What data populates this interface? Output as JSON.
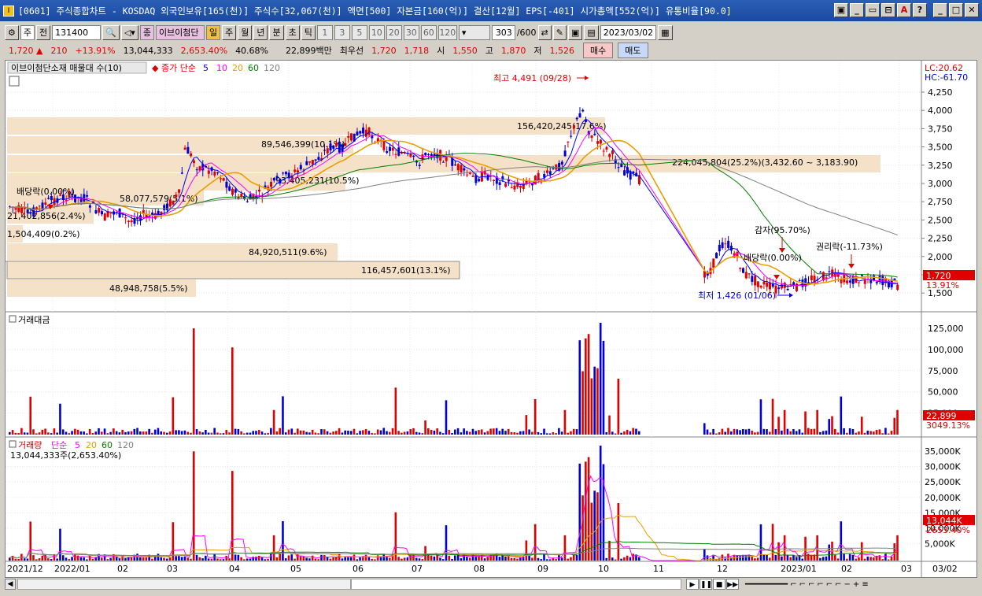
{
  "window": {
    "title": "[0601] 주식종합차트 - KOSDAQ 외국인보유[165(천)] 주식수[32,067(천)] 액면[500] 자본금[160(억)] 결산[12월] EPS[-401] 시가총액[552(억)] 유통비율[90.0]",
    "buttons": [
      "▣",
      "_",
      "□",
      "▭",
      "A",
      "?",
      "_",
      "□",
      "X"
    ]
  },
  "toolbar": {
    "period": "주",
    "jeon": "전",
    "code": "131400",
    "name": "이브이첨단",
    "badge": "종",
    "timeframes": [
      "일",
      "주",
      "월",
      "년",
      "분",
      "초",
      "틱"
    ],
    "selected_timeframe": "일",
    "intervals": [
      "1",
      "3",
      "5",
      "10",
      "20",
      "30",
      "60",
      "120"
    ],
    "count": "303",
    "count_total": "/600",
    "date": "2023/03/02"
  },
  "quote": {
    "price": "1,720",
    "change": "210",
    "change_pct": "+13.91%",
    "volume": "13,044,333",
    "volume_pct": "2,653.40%",
    "ratio": "40.68%",
    "amount": "22,899백만",
    "best_bid_label": "최우선",
    "best_ask": "1,720",
    "best_bid": "1,718",
    "open_label": "시",
    "open": "1,550",
    "high_label": "고",
    "high": "1,870",
    "low_label": "저",
    "low": "1,526",
    "buy_label": "매수",
    "sell_label": "매도"
  },
  "price_panel": {
    "title": "이브이첨단소재 매물대 수(10)",
    "ma_label": "종가 단순",
    "ma_periods": [
      "5",
      "10",
      "20",
      "60",
      "120"
    ],
    "ma_colors": [
      "#0000ff",
      "#ff00ff",
      "#e8a000",
      "#008000",
      "#808080"
    ],
    "lc": "LC:20.62",
    "hc": "HC:-61.70",
    "yticks": [
      "4,250",
      "4,000",
      "3,750",
      "3,500",
      "3,250",
      "3,000",
      "2,750",
      "2,500",
      "2,250",
      "2,000",
      "1,750",
      "1,500"
    ],
    "current_price": "1,720",
    "current_pct": "13.91%",
    "high_marker": "최고 4,491 (09/28)",
    "low_marker": "최저 1,426 (01/06)",
    "events": [
      "배당락(0.00%)",
      "감자(95.70%)",
      "배당락(0.00%)",
      "권리락(-11.73%)"
    ],
    "volume_profile": [
      "156,420,245(17.6%)",
      "89,546,399(10.1%)",
      "224,045,804(25.2%)(3,432.60 ~ 3,183.90)",
      "93,405,231(10.5%)",
      "58,077,579(5.1%)",
      "21,402,856(2.4%)",
      "1,504,409(0.2%)",
      "84,920,511(9.6%)",
      "116,457,601(13.1%)",
      "48,948,758(5.5%)"
    ]
  },
  "amount_panel": {
    "title": "거래대금",
    "yticks": [
      "125,000",
      "100,000",
      "75,000",
      "50,000",
      "25,000"
    ],
    "current": "22,899",
    "current_pct": "3049.13%"
  },
  "volume_panel": {
    "title": "거래량",
    "ma_label": "단순",
    "ma_periods": [
      "5",
      "20",
      "60",
      "120"
    ],
    "ma_colors": [
      "#ff00ff",
      "#e8a000",
      "#008000",
      "#808080"
    ],
    "value": "13,044,333주(2,653.40%)",
    "yticks": [
      "35,000K",
      "30,000K",
      "25,000K",
      "20,000K",
      "15,000K",
      "10,000K",
      "5,000K"
    ],
    "current": "13,044K",
    "current_pct": "2653.40%"
  },
  "xaxis": [
    "2021/12",
    "2022/01",
    "02",
    "03",
    "04",
    "05",
    "06",
    "07",
    "08",
    "09",
    "10",
    "11",
    "12",
    "2023/01",
    "02",
    "03",
    "03/02"
  ]
}
